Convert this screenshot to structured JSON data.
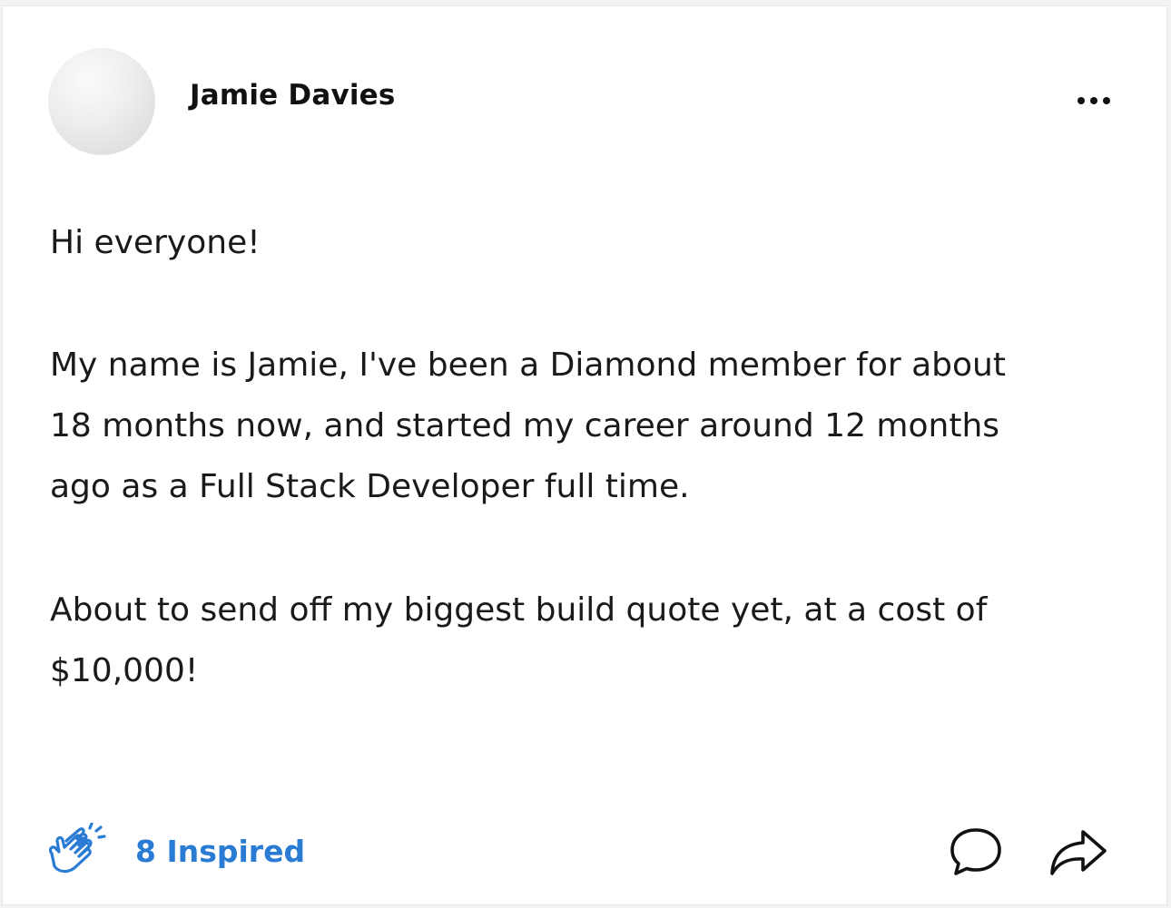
{
  "post": {
    "author": "Jamie Davies",
    "paragraphs": [
      "Hi everyone!",
      "My name is Jamie, I've been a Diamond member for about\n18 months now, and started my career around 12 months\nago as a Full Stack Developer full time.",
      "About to send off my biggest build quote yet, at a cost of\n$10,000!"
    ]
  },
  "reaction": {
    "label": "8 Inspired",
    "icon": "clapping-hands-icon",
    "color": "#2a7bd4"
  },
  "actions": {
    "more_icon": "more-options-icon",
    "comment_icon": "comment-bubble-icon",
    "share_icon": "share-arrow-icon"
  }
}
